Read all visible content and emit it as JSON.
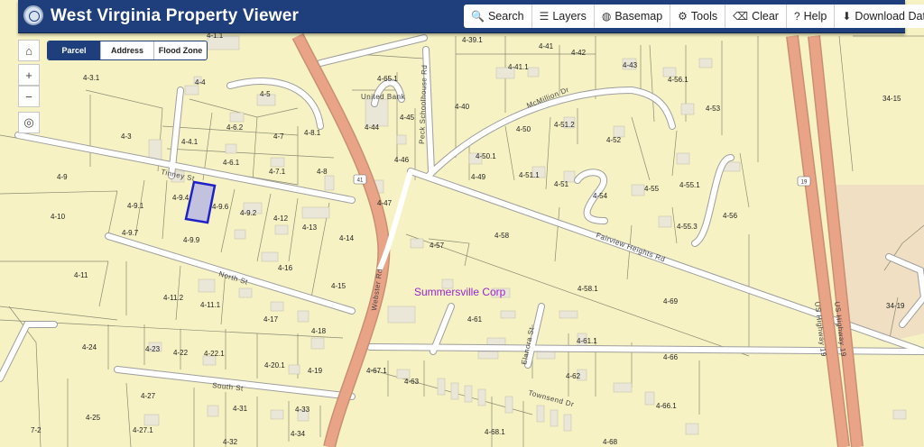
{
  "app": {
    "title": "West Virginia Property Viewer"
  },
  "toolbar": [
    {
      "icon": "search-icon",
      "glyph": "🔍",
      "label": "Search"
    },
    {
      "icon": "layers-icon",
      "glyph": "☰",
      "label": "Layers"
    },
    {
      "icon": "globe-icon",
      "glyph": "◍",
      "label": "Basemap"
    },
    {
      "icon": "gear-icon",
      "glyph": "⚙",
      "label": "Tools"
    },
    {
      "icon": "eraser-icon",
      "glyph": "⌫",
      "label": "Clear"
    },
    {
      "icon": "question-icon",
      "glyph": "?",
      "label": "Help"
    },
    {
      "icon": "download-icon",
      "glyph": "⬇",
      "label": "Download Data"
    }
  ],
  "search_tabs": [
    {
      "label": "Parcel",
      "active": true
    },
    {
      "label": "Address",
      "active": false
    },
    {
      "label": "Flood Zone",
      "active": false
    }
  ],
  "map_controls": {
    "home": "⌂",
    "zoom_in": "+",
    "zoom_out": "−",
    "locate": "◎"
  },
  "map": {
    "place_label": "Summersville Corp",
    "places": [
      "United Bank"
    ],
    "streets": [
      "Webster Rd",
      "Fairview Heights Rd",
      "McMillion Dr",
      "Peck Schoolhouse Rd",
      "Townsend Dr",
      "North St",
      "South St",
      "Tinney St",
      "Elanora St",
      "US Highway 19",
      "US Highway 19"
    ],
    "route_shields": [
      "41",
      "19"
    ],
    "selected_parcel": "4-9.5",
    "parcels": [
      "4-1.1",
      "4-3.1",
      "4-4",
      "4-5",
      "4-65.1",
      "4-39.1",
      "4-41",
      "4-41.1",
      "4-42",
      "4-43",
      "4-56.1",
      "34-15",
      "4-53",
      "4-40",
      "4-45",
      "4-44",
      "4-50",
      "4-51.2",
      "4-52",
      "4-3",
      "4-6.2",
      "4-7",
      "4-8.1",
      "4-4.1",
      "4-6.1",
      "4-7.1",
      "4-8",
      "4-46",
      "4-50.1",
      "4-51.1",
      "4-49",
      "4-51",
      "4-54",
      "4-55",
      "4-55.1",
      "4-56",
      "4-9",
      "4-9.4",
      "4-9.6",
      "4-9.1",
      "4-9.2",
      "4-12",
      "4-47",
      "4-10",
      "4-13",
      "4-14",
      "4-9.7",
      "4-9.9",
      "4-57",
      "4-58",
      "4-55.3",
      "4-11",
      "4-16",
      "4-15",
      "4-58.1",
      "4-69",
      "4-11.2",
      "4-11.1",
      "34-19",
      "4-17",
      "4-61",
      "4-18",
      "4-61.1",
      "4-24",
      "4-23",
      "4-22",
      "4-22.1",
      "4-20.1",
      "4-19",
      "4-67.1",
      "4-63",
      "4-62",
      "4-66",
      "4-27",
      "4-31",
      "4-33",
      "4-66.1",
      "4-25",
      "4-27.1",
      "4-34",
      "7-2",
      "4-32",
      "4-68.1",
      "4-68"
    ]
  }
}
